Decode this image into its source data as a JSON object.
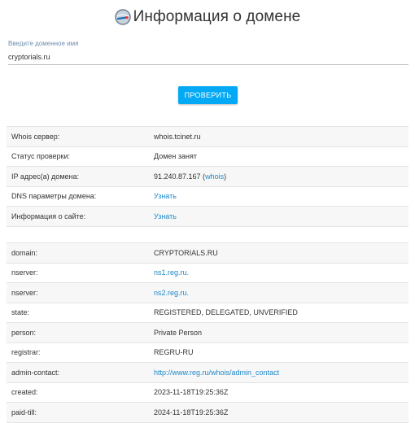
{
  "header": {
    "title": "Информация о домене",
    "logo_icon": "globe-search-icon"
  },
  "search": {
    "label": "Введите доменное имя",
    "value": "cryptorials.ru"
  },
  "check_button": {
    "label": "ПРОВЕРИТЬ"
  },
  "summary": {
    "whois_server": {
      "label": "Whois сервер:",
      "value": "whois.tcinet.ru"
    },
    "status": {
      "label": "Статус проверки:",
      "value": "Домен занят"
    },
    "ip": {
      "label": "IP адрес(а) домена:",
      "value": "91.240.87.167 (",
      "link": "whois",
      "suffix": ")"
    },
    "dns": {
      "label": "DNS параметры домена:",
      "link": "Узнать"
    },
    "site_info": {
      "label": "Информация о сайте:",
      "link": "Узнать"
    }
  },
  "whois": {
    "domain": {
      "label": "domain:",
      "value": "CRYPTORIALS.RU"
    },
    "nserver1": {
      "label": "nserver:",
      "link": "ns1.reg.ru."
    },
    "nserver2": {
      "label": "nserver:",
      "link": "ns2.reg.ru."
    },
    "state": {
      "label": "state:",
      "value": "REGISTERED, DELEGATED, UNVERIFIED"
    },
    "person": {
      "label": "person:",
      "value": "Private Person"
    },
    "registrar": {
      "label": "registrar:",
      "value": "REGRU-RU"
    },
    "admin_contact": {
      "label": "admin-contact:",
      "link": "http://www.reg.ru/whois/admin_contact"
    },
    "created": {
      "label": "created:",
      "value": "2023-11-18T19:25:36Z"
    },
    "paid_till": {
      "label": "paid-till:",
      "value": "2024-11-18T19:25:36Z"
    }
  },
  "colors": {
    "accent": "#03a9f4",
    "link": "#1e88c8",
    "row_alt": "#f7f7f7"
  }
}
